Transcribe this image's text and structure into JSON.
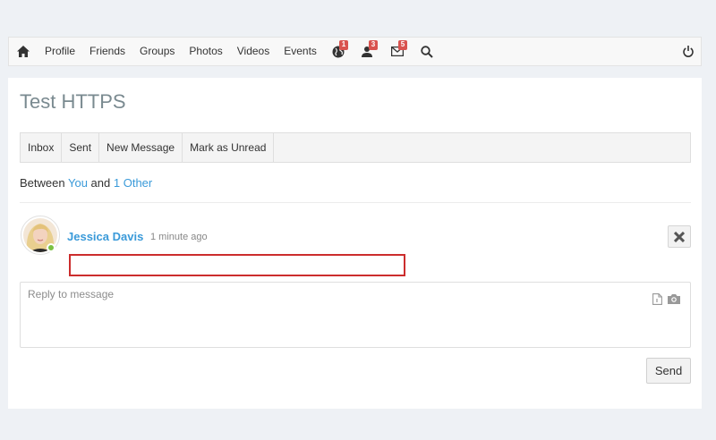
{
  "navbar": {
    "links": [
      "Profile",
      "Friends",
      "Groups",
      "Photos",
      "Videos",
      "Events"
    ],
    "notifications": [
      {
        "icon": "globe-icon",
        "count": "1"
      },
      {
        "icon": "friend-requests-icon",
        "count": "3"
      },
      {
        "icon": "messages-icon",
        "count": "5"
      }
    ]
  },
  "page": {
    "title": "Test HTTPS"
  },
  "tabs": [
    "Inbox",
    "Sent",
    "New Message",
    "Mark as Unread"
  ],
  "conversation": {
    "between_prefix": "Between",
    "participant_you": "You",
    "conjunction": "and",
    "participant_other": "1 Other"
  },
  "message": {
    "author": "Jessica Davis",
    "time": "1 minute ago",
    "body": ""
  },
  "reply": {
    "placeholder": "Reply to message",
    "send_label": "Send"
  },
  "colors": {
    "link": "#3a9ad9",
    "badge": "#d9534f",
    "highlight_border": "#cc2d2d",
    "online": "#7ac142"
  }
}
